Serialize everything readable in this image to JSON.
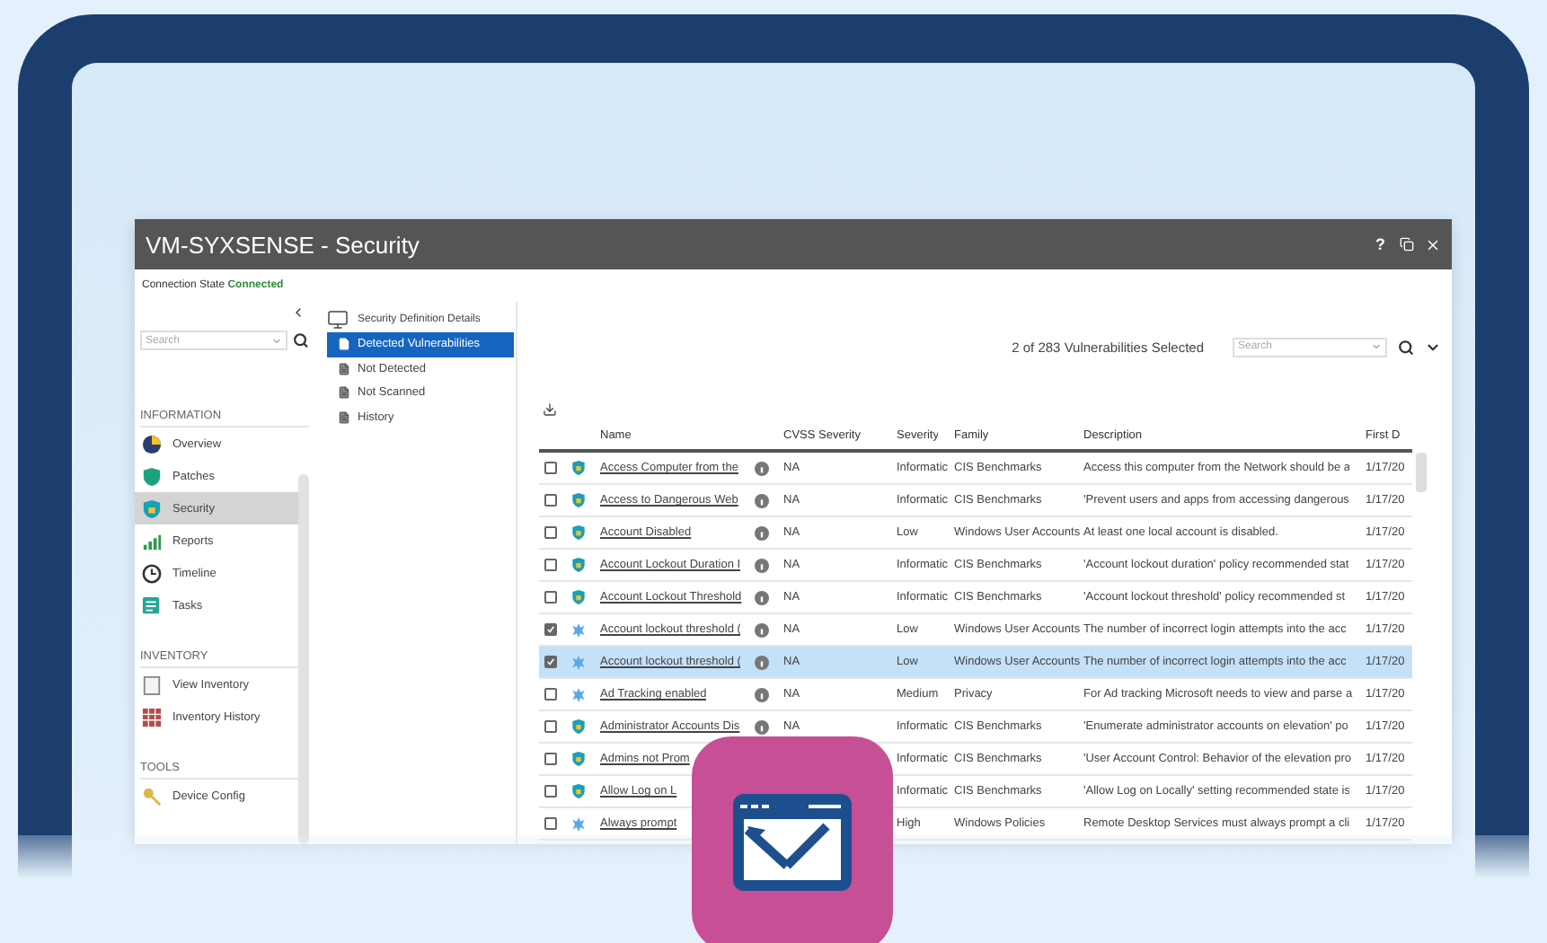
{
  "window": {
    "title": "VM-SYXSENSE - Security",
    "help": "?"
  },
  "connection": {
    "label": "Connection State",
    "value": "Connected"
  },
  "sidebar": {
    "search_placeholder": "Search",
    "sections": [
      {
        "title": "INFORMATION",
        "items": [
          {
            "label": "Overview",
            "kind": "overview",
            "selected": false
          },
          {
            "label": "Patches",
            "kind": "patches",
            "selected": false
          },
          {
            "label": "Security",
            "kind": "security",
            "selected": true
          },
          {
            "label": "Reports",
            "kind": "reports",
            "selected": false
          },
          {
            "label": "Timeline",
            "kind": "timeline",
            "selected": false
          },
          {
            "label": "Tasks",
            "kind": "tasks",
            "selected": false
          }
        ]
      },
      {
        "title": "INVENTORY",
        "items": [
          {
            "label": "View Inventory",
            "kind": "inventory",
            "selected": false
          },
          {
            "label": "Inventory History",
            "kind": "history",
            "selected": false
          }
        ]
      },
      {
        "title": "TOOLS",
        "items": [
          {
            "label": "Device Config",
            "kind": "config",
            "selected": false
          }
        ]
      }
    ]
  },
  "tree": {
    "title": "Security Definition Details",
    "items": [
      {
        "label": "Detected Vulnerabilities",
        "selected": true
      },
      {
        "label": "Not Detected",
        "selected": false
      },
      {
        "label": "Not Scanned",
        "selected": false
      },
      {
        "label": "History",
        "selected": false
      }
    ]
  },
  "table": {
    "summary": "2 of 283 Vulnerabilities Selected",
    "search_placeholder": "Search",
    "columns": [
      "Name",
      "CVSS Severity",
      "Severity",
      "Family",
      "Description",
      "First D"
    ],
    "rows": [
      {
        "kind": "shield",
        "name": "Access Computer from the",
        "cvss": "NA",
        "severity": "Informatic",
        "family": "CIS Benchmarks",
        "description": "Access this computer from the Network should be a",
        "first": "1/17/20",
        "checked": false,
        "selected": false
      },
      {
        "kind": "shield",
        "name": "Access to Dangerous Web",
        "cvss": "NA",
        "severity": "Informatic",
        "family": "CIS Benchmarks",
        "description": "'Prevent users and apps from accessing dangerous",
        "first": "1/17/20",
        "checked": false,
        "selected": false
      },
      {
        "kind": "shield",
        "name": "Account Disabled",
        "cvss": "NA",
        "severity": "Low",
        "family": "Windows User Accounts",
        "description": "At least one local account is disabled.",
        "first": "1/17/20",
        "checked": false,
        "selected": false
      },
      {
        "kind": "shield",
        "name": "Account Lockout Duration I",
        "cvss": "NA",
        "severity": "Informatic",
        "family": "CIS Benchmarks",
        "description": "'Account lockout duration' policy recommended stat",
        "first": "1/17/20",
        "checked": false,
        "selected": false
      },
      {
        "kind": "shield",
        "name": "Account Lockout Threshold",
        "cvss": "NA",
        "severity": "Informatic",
        "family": "CIS Benchmarks",
        "description": "'Account lockout threshold' policy recommended st",
        "first": "1/17/20",
        "checked": false,
        "selected": false
      },
      {
        "kind": "gear",
        "name": "Account lockout threshold (",
        "cvss": "NA",
        "severity": "Low",
        "family": "Windows User Accounts",
        "description": "The number of incorrect login attempts into the acc",
        "first": "1/17/20",
        "checked": true,
        "selected": false
      },
      {
        "kind": "gear",
        "name": "Account lockout threshold (",
        "cvss": "NA",
        "severity": "Low",
        "family": "Windows User Accounts",
        "description": "The number of incorrect login attempts into the acc",
        "first": "1/17/20",
        "checked": true,
        "selected": true
      },
      {
        "kind": "gear",
        "name": "Ad Tracking enabled",
        "cvss": "NA",
        "severity": "Medium",
        "family": "Privacy",
        "description": "For Ad tracking Microsoft needs to view and parse a",
        "first": "1/17/20",
        "checked": false,
        "selected": false
      },
      {
        "kind": "shield",
        "name": "Administrator Accounts Dis",
        "cvss": "NA",
        "severity": "Informatic",
        "family": "CIS Benchmarks",
        "description": "'Enumerate administrator accounts on elevation' po",
        "first": "1/17/20",
        "checked": false,
        "selected": false
      },
      {
        "kind": "shield",
        "name": "Admins not Prom",
        "severity": "Informatic",
        "family": "CIS Benchmarks",
        "description": "'User Account Control: Behavior of the elevation pro",
        "first": "1/17/20",
        "checked": false,
        "selected": false
      },
      {
        "kind": "shield",
        "name": "Allow Log on L",
        "severity": "Informatic",
        "family": "CIS Benchmarks",
        "description": "'Allow Log on Locally' setting recommended state is",
        "first": "1/17/20",
        "checked": false,
        "selected": false
      },
      {
        "kind": "gear",
        "name": "Always prompt",
        "severity": "High",
        "family": "Windows Policies",
        "description": "Remote Desktop Services must always prompt a cli",
        "first": "1/17/20",
        "checked": false,
        "selected": false
      }
    ]
  }
}
